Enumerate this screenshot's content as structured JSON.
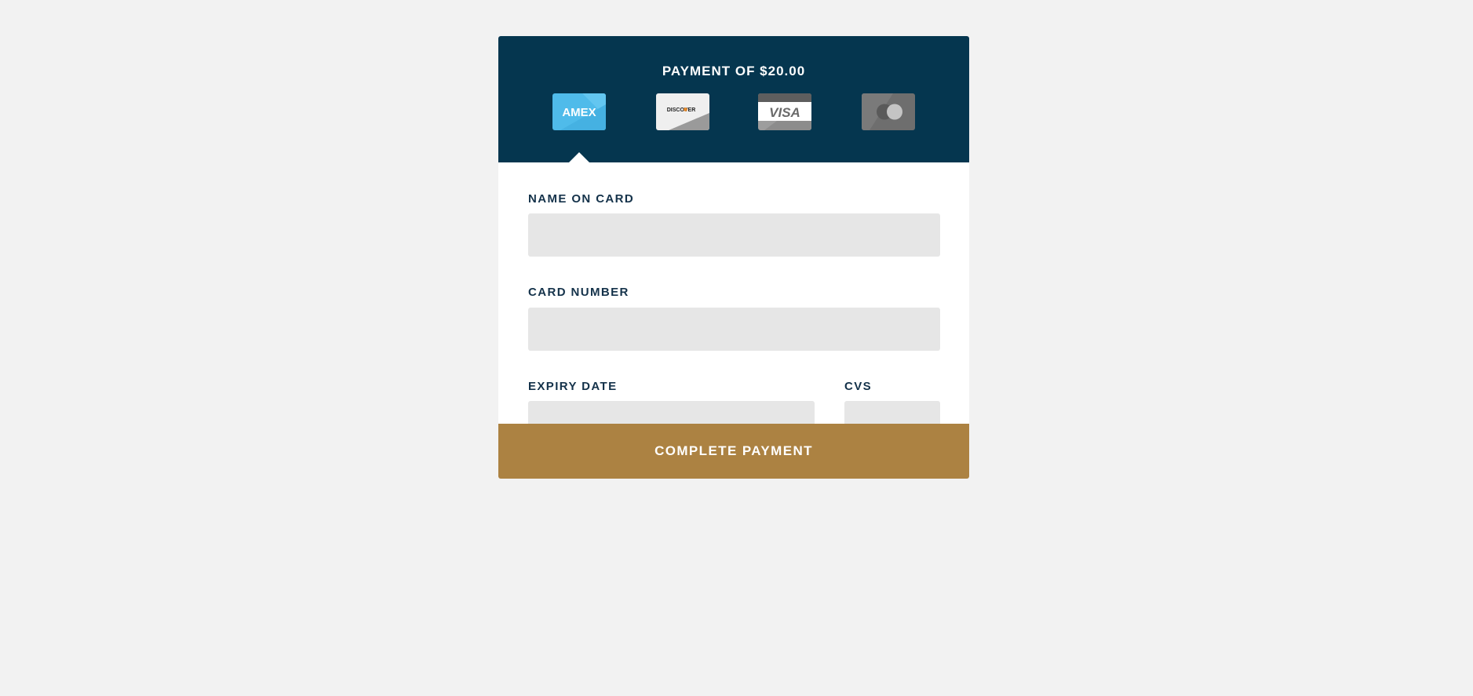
{
  "header": {
    "title": "PAYMENT OF $20.00",
    "background": "#05364f",
    "cards": [
      {
        "name": "amex",
        "label": "AMEX",
        "icon": "amex-card-icon",
        "color": "#4fbbea",
        "selected": true
      },
      {
        "name": "discover",
        "label": "DISCOVER",
        "icon": "discover-card-icon",
        "color": "#efefef",
        "selected": false
      },
      {
        "name": "visa",
        "label": "VISA",
        "icon": "visa-card-icon",
        "color": "#ffffff",
        "selected": false
      },
      {
        "name": "mastercard",
        "label": "",
        "icon": "mastercard-card-icon",
        "color": "#6e6e6e",
        "selected": false
      }
    ]
  },
  "form": {
    "name_label": "NAME ON CARD",
    "name_value": "",
    "number_label": "CARD NUMBER",
    "number_value": "",
    "expiry_label": "EXPIRY DATE",
    "expiry_placeholder": "---------  ----",
    "expiry_value": "",
    "cvs_label": "CVS",
    "cvs_value": "",
    "input_background": "#e6e6e6",
    "label_color": "#14324a"
  },
  "submit": {
    "label": "COMPLETE PAYMENT",
    "color": "#ac8242"
  }
}
